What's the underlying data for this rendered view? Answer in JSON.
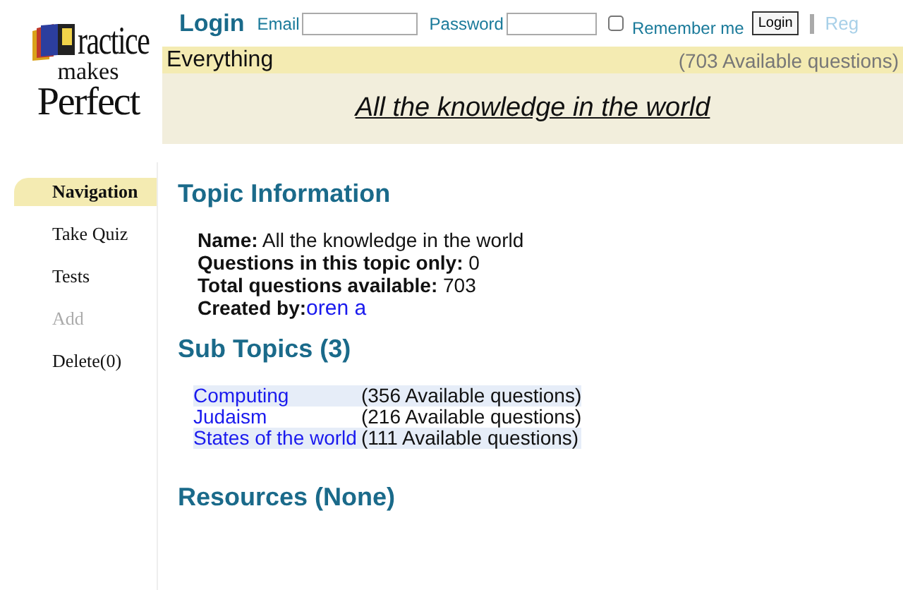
{
  "logo": {
    "lines": [
      "ractice",
      "makes",
      "Perfect"
    ]
  },
  "login": {
    "title": "Login",
    "email_label": "Email",
    "password_label": "Password",
    "remember": {
      "label": "Remember me",
      "checked": false
    },
    "button": "Login",
    "register": "Reg"
  },
  "topic_bar": {
    "name": "Everything",
    "count": "(703 Available questions)",
    "heading": "All the knowledge in the world"
  },
  "navigation": [
    {
      "label": "Navigation",
      "selected": true,
      "disabled": false
    },
    {
      "label": "Take Quiz",
      "selected": false,
      "disabled": false
    },
    {
      "label": "Tests",
      "selected": false,
      "disabled": false
    },
    {
      "label": "Add",
      "selected": false,
      "disabled": true
    },
    {
      "label": "Delete(0)",
      "selected": false,
      "disabled": false
    }
  ],
  "topic_information": {
    "title": "Topic Information",
    "fields": [
      {
        "label": "Name:",
        "value": "All the knowledge in the world",
        "kind": "text"
      },
      {
        "label": "Questions in this topic only:",
        "value": "0",
        "kind": "text"
      },
      {
        "label": "Total questions available:",
        "value": "703",
        "kind": "text"
      },
      {
        "label": "Created by:",
        "value": "oren a",
        "kind": "link"
      }
    ]
  },
  "sub_topics": {
    "title": "Sub Topics (3)",
    "rows": [
      {
        "name": "Computing",
        "count": "(356 Available questions)",
        "shaded": true
      },
      {
        "name": "Judaism",
        "count": "(216 Available questions)",
        "shaded": false
      },
      {
        "name": "States of the world",
        "count": "(111 Available questions)",
        "shaded": true
      }
    ]
  },
  "resources": {
    "title": "Resources (None)"
  }
}
